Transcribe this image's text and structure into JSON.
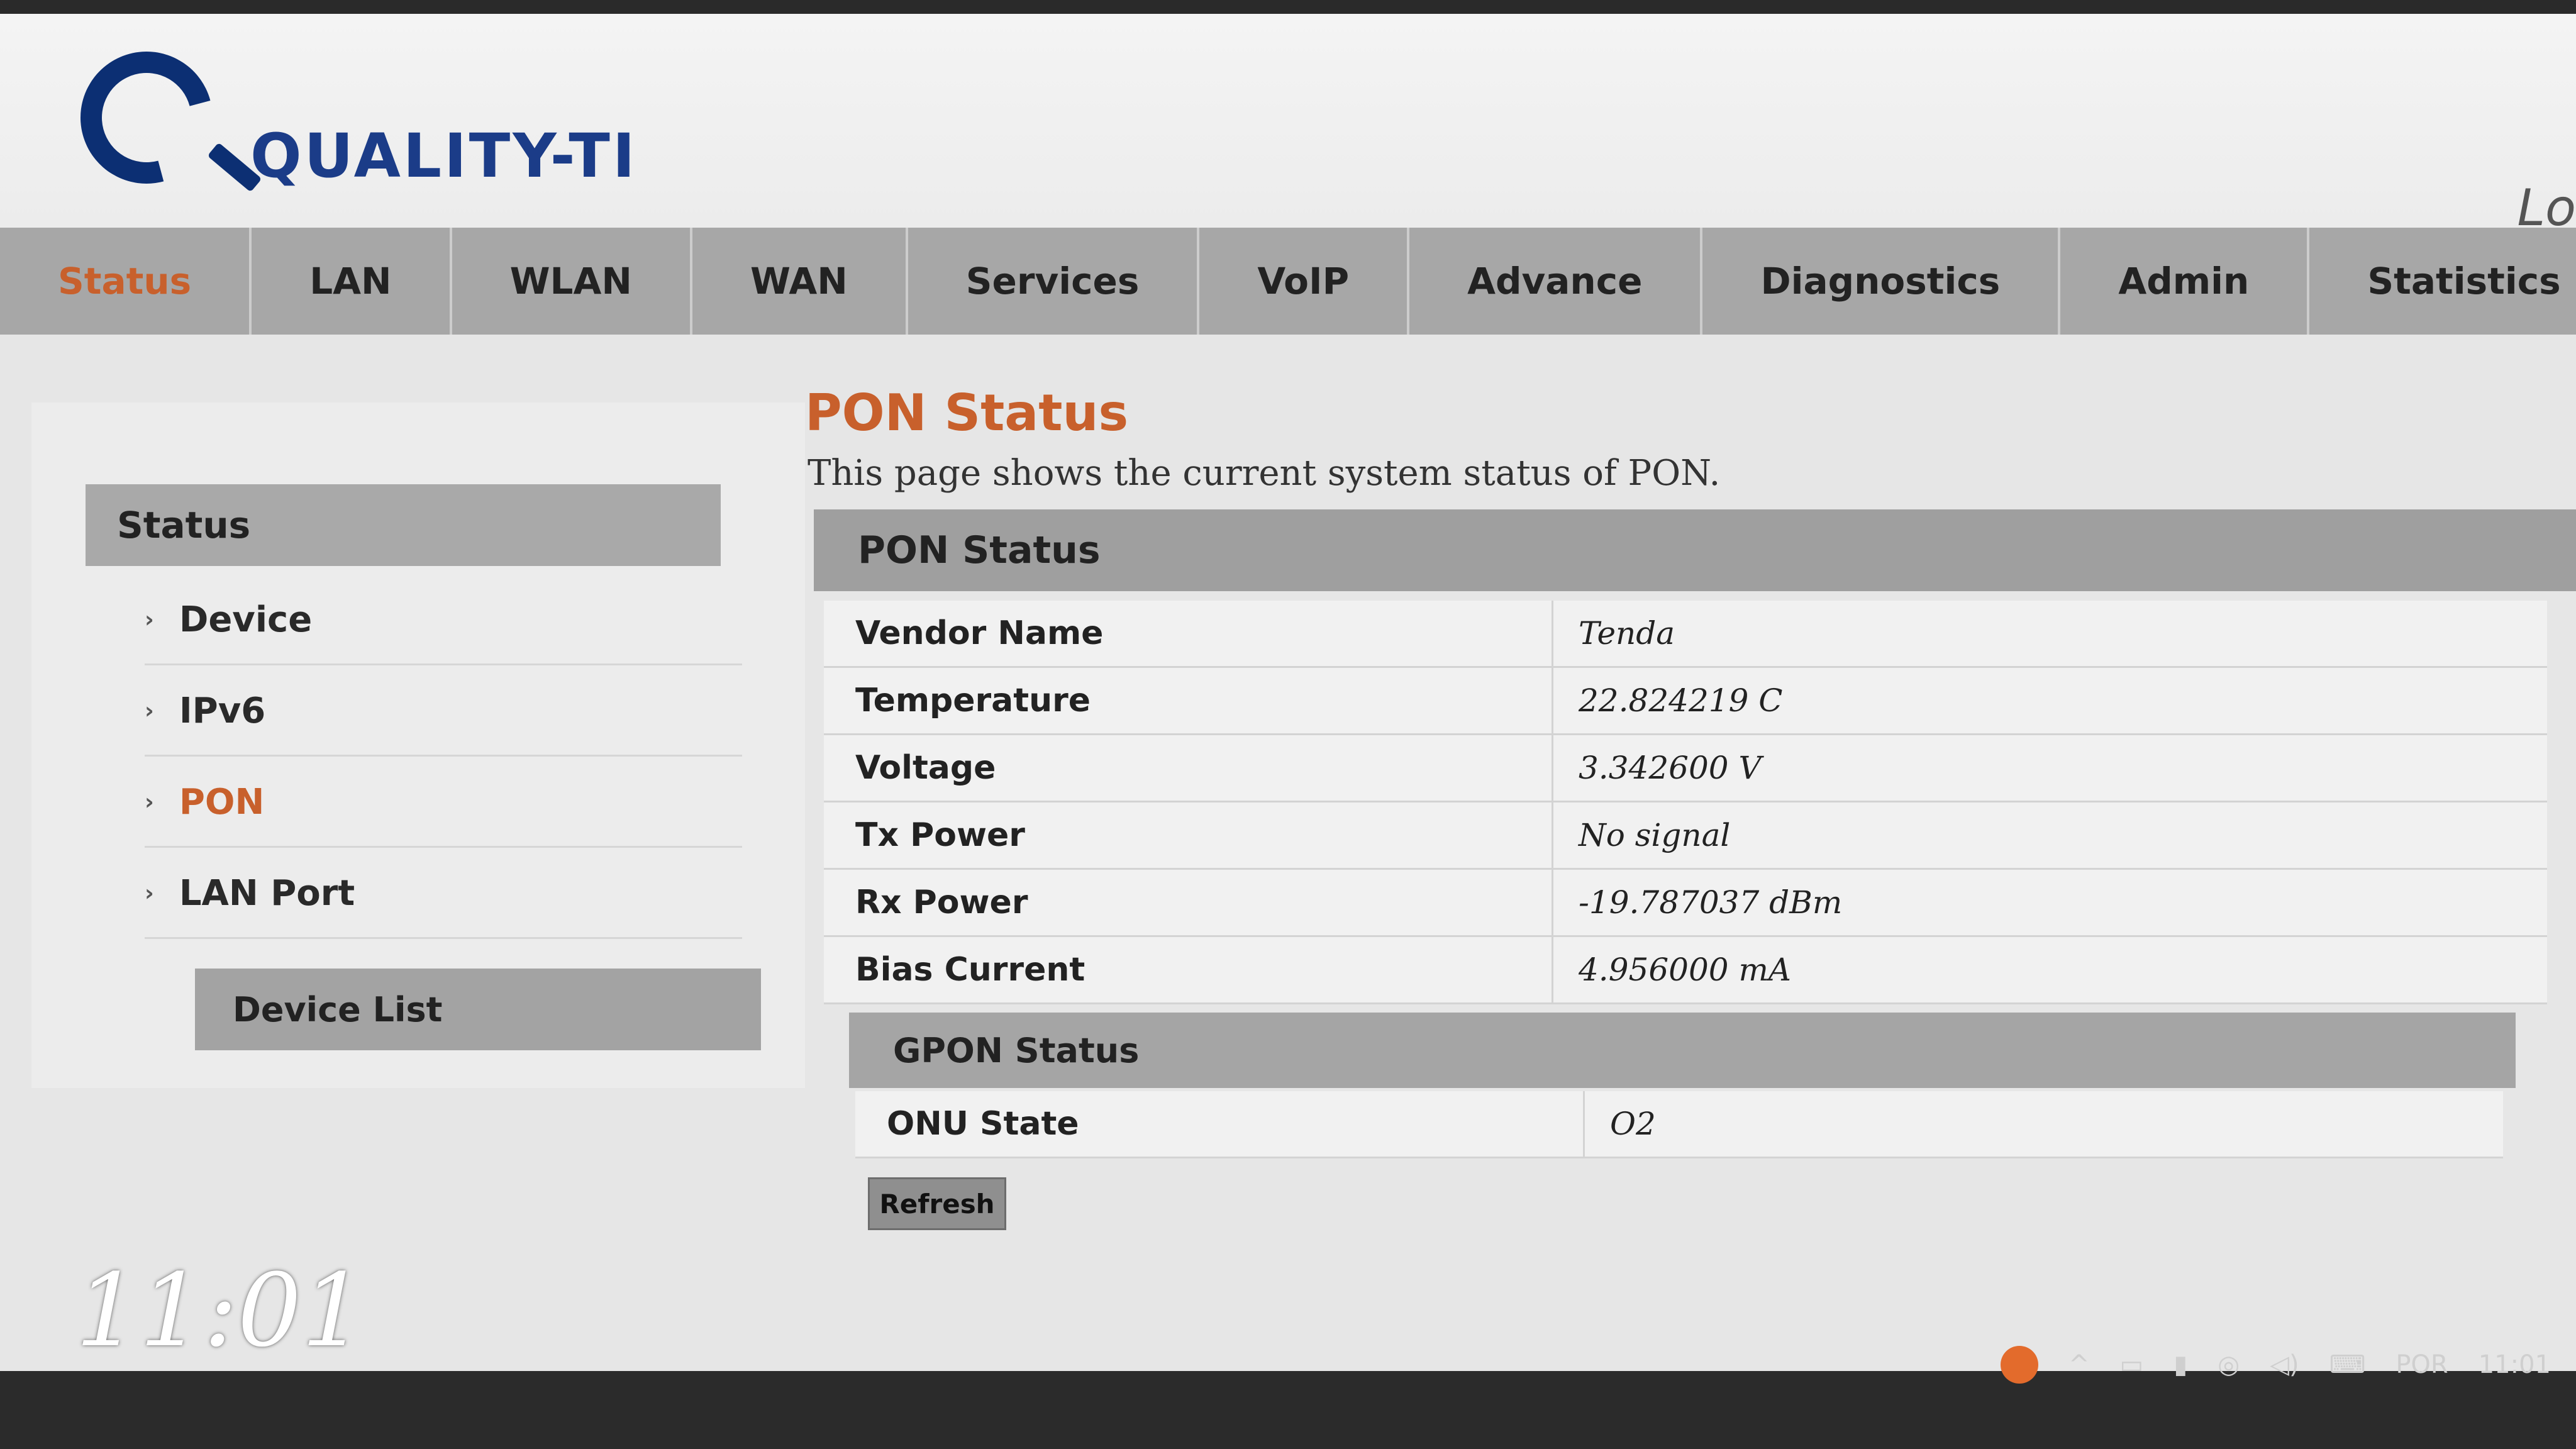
{
  "logo": {
    "text": "QUALITY-TI"
  },
  "header": {
    "logout_partial": "Lo"
  },
  "nav": [
    {
      "label": "Status",
      "active": true
    },
    {
      "label": "LAN"
    },
    {
      "label": "WLAN"
    },
    {
      "label": "WAN"
    },
    {
      "label": "Services"
    },
    {
      "label": "VoIP"
    },
    {
      "label": "Advance"
    },
    {
      "label": "Diagnostics"
    },
    {
      "label": "Admin"
    },
    {
      "label": "Statistics"
    }
  ],
  "sidebar": {
    "heading": "Status",
    "items": [
      {
        "label": "Device"
      },
      {
        "label": "IPv6"
      },
      {
        "label": "PON",
        "active": true
      },
      {
        "label": "LAN Port"
      }
    ],
    "device_list": "Device List"
  },
  "page": {
    "title": "PON Status",
    "description": "This page shows the current system status of PON."
  },
  "pon_status": {
    "heading": "PON Status",
    "rows": [
      {
        "label": "Vendor Name",
        "value": "Tenda"
      },
      {
        "label": "Temperature",
        "value": "22.824219 C"
      },
      {
        "label": "Voltage",
        "value": "3.342600 V"
      },
      {
        "label": "Tx Power",
        "value": "No signal"
      },
      {
        "label": "Rx Power",
        "value": "-19.787037 dBm"
      },
      {
        "label": "Bias Current",
        "value": "4.956000 mA"
      }
    ]
  },
  "gpon_status": {
    "heading": "GPON Status",
    "rows": [
      {
        "label": "ONU State",
        "value": "O2"
      }
    ]
  },
  "buttons": {
    "refresh": "Refresh"
  },
  "overlay": {
    "clock": "11:01"
  },
  "taskbar": {
    "lang": "POR",
    "time": "11:01"
  },
  "colors": {
    "accent": "#c8602c",
    "logo": "#0c2f73",
    "nav_bg": "#a7a7a7"
  }
}
